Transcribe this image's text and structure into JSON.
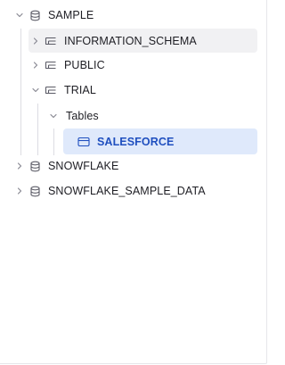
{
  "tree": {
    "root": {
      "label": "SAMPLE",
      "icon": "database-icon",
      "expanded": true
    },
    "schemas": [
      {
        "label": "INFORMATION_SCHEMA",
        "icon": "schema-icon",
        "expanded": false
      },
      {
        "label": "PUBLIC",
        "icon": "schema-icon",
        "expanded": false
      },
      {
        "label": "TRIAL",
        "icon": "schema-icon",
        "expanded": true
      }
    ],
    "trial_folder": {
      "label": "Tables",
      "expanded": true
    },
    "trial_tables": [
      {
        "label": "SALESFORCE",
        "icon": "table-icon",
        "selected": true
      }
    ],
    "other_databases": [
      {
        "label": "SNOWFLAKE",
        "icon": "database-icon",
        "expanded": false
      },
      {
        "label": "SNOWFLAKE_SAMPLE_DATA",
        "icon": "database-icon",
        "expanded": false
      }
    ]
  },
  "colors": {
    "text": "#1e1e24",
    "icon": "#5b5b66",
    "selected_bg": "#dfe9fb",
    "selected_text": "#1f4fbf",
    "hover_bg": "#f1f1f3",
    "guide_line": "#dcdce2"
  }
}
